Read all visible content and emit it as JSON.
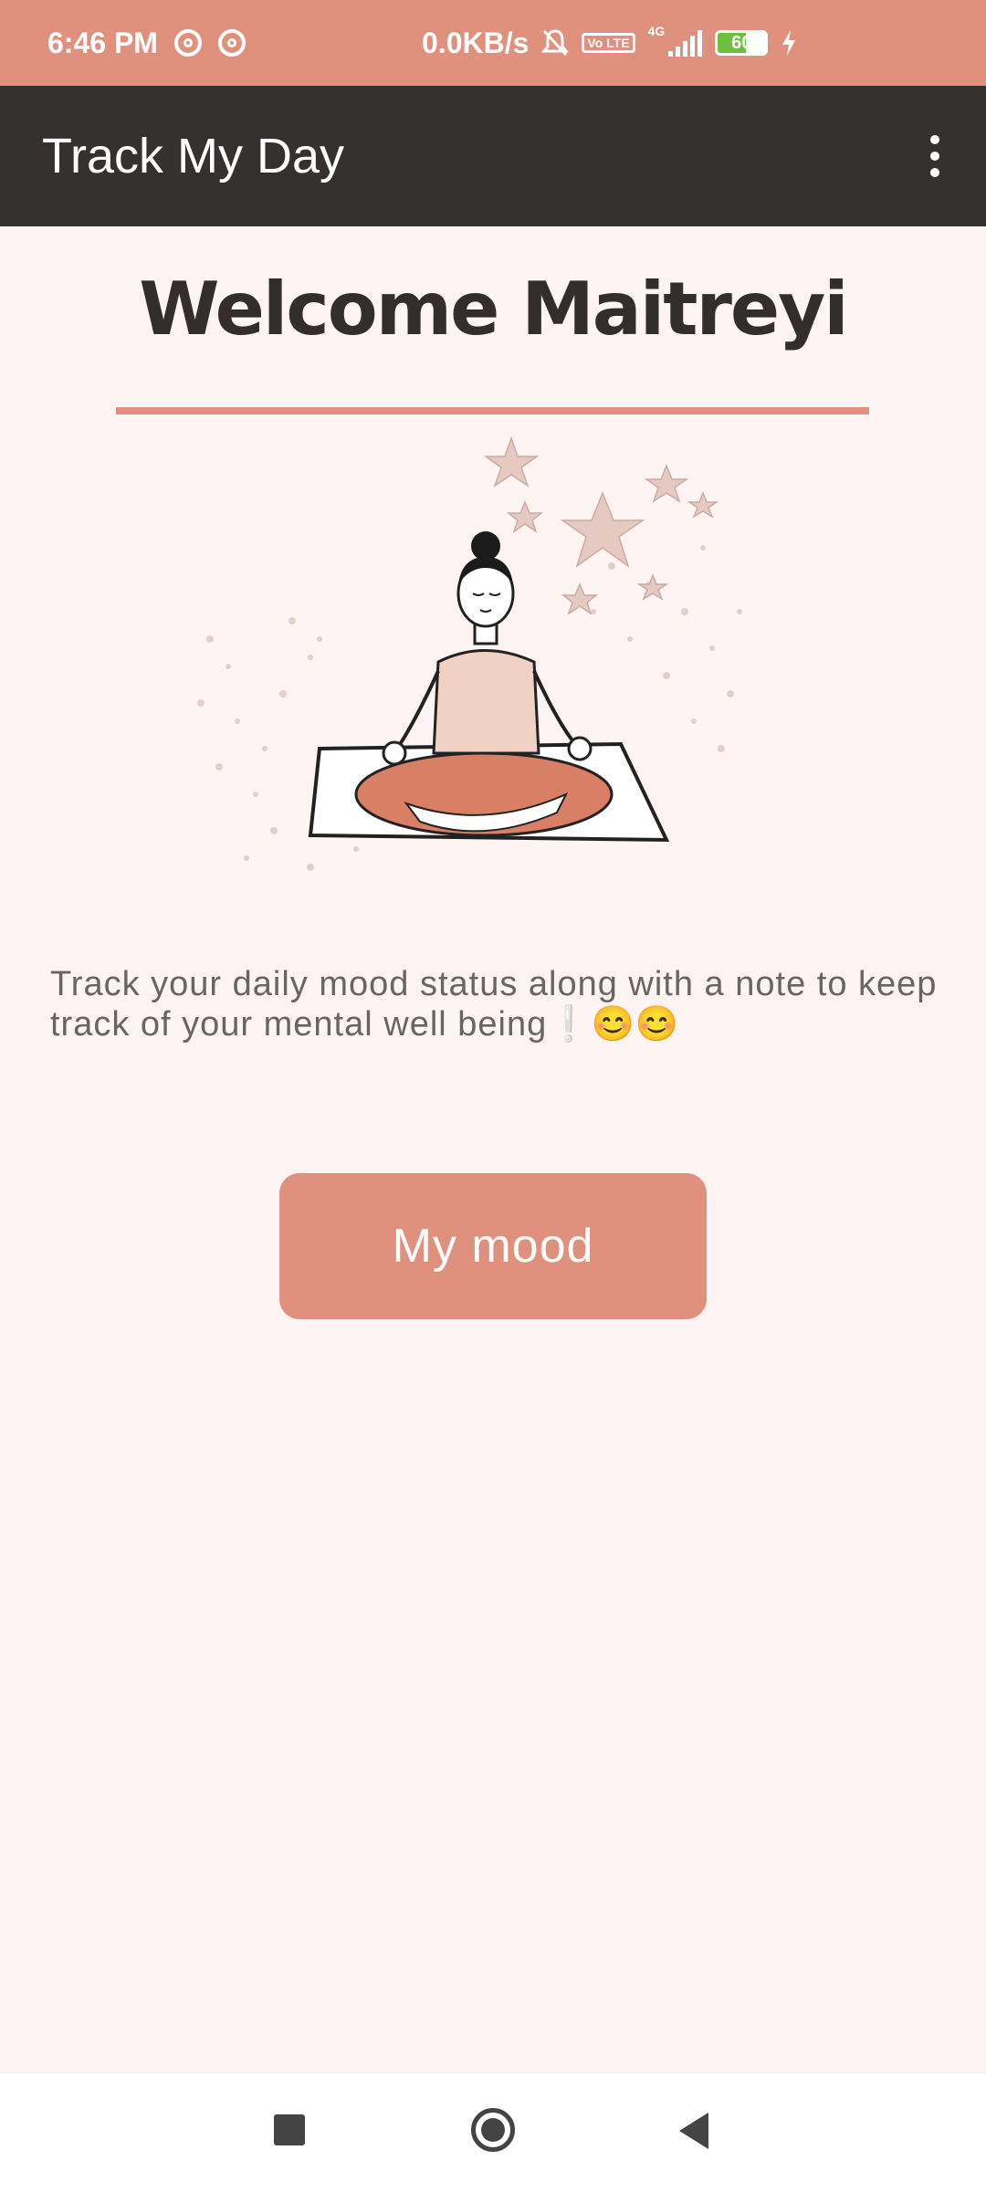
{
  "status_bar": {
    "time": "6:46 PM",
    "net_speed": "0.0KB/s",
    "volte": "Vo LTE",
    "network_type": "4G",
    "battery_level": "60",
    "battery_level_fraction": 0.6
  },
  "app_bar": {
    "title": "Track My Day",
    "overflow_icon": "more-vert-icon"
  },
  "main": {
    "welcome": "Welcome Maitreyi",
    "description": "Track your daily mood status along with a note to keep track of your mental well being❕😊😊",
    "mood_button_label": "My mood"
  },
  "colors": {
    "accent": "#e0917d",
    "app_bar": "#363131",
    "background": "#fdf4f3"
  },
  "nav_bar": {
    "recent": "recent-apps-icon",
    "home": "home-icon",
    "back": "back-icon"
  }
}
